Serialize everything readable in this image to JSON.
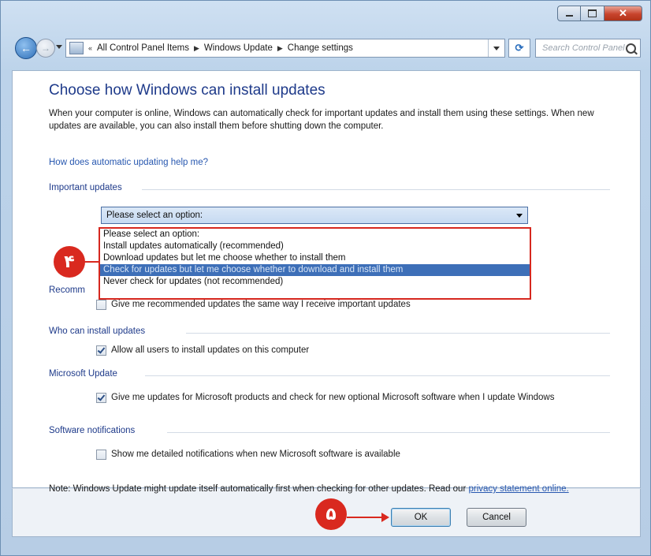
{
  "window": {
    "caption_buttons": [
      "minimize",
      "maximize",
      "close"
    ]
  },
  "nav": {
    "breadcrumb": [
      "All Control Panel Items",
      "Windows Update",
      "Change settings"
    ],
    "search_placeholder": "Search Control Panel"
  },
  "page": {
    "title": "Choose how Windows can install updates",
    "intro": "When your computer is online, Windows can automatically check for important updates and install them using these settings. When new updates are available, you can also install them before shutting down the computer.",
    "help_link": "How does automatic updating help me?"
  },
  "important_updates": {
    "label": "Important updates",
    "selected": "Please select an option:",
    "options": [
      "Please select an option:",
      "Install updates automatically (recommended)",
      "Download updates but let me choose whether to install them",
      "Check for updates but let me choose whether to download and install them",
      "Never check for updates (not recommended)"
    ],
    "highlighted_index": 3
  },
  "recommended_updates": {
    "label_partial": "Recomm",
    "checkbox_label": "Give me recommended updates the same way I receive important updates",
    "checked": false
  },
  "who_can_install": {
    "label": "Who can install updates",
    "checkbox_label": "Allow all users to install updates on this computer",
    "checked": true
  },
  "microsoft_update": {
    "label": "Microsoft Update",
    "checkbox_label": "Give me updates for Microsoft products and check for new optional Microsoft software when I update Windows",
    "checked": true
  },
  "software_notifications": {
    "label": "Software notifications",
    "checkbox_label": "Show me detailed notifications when new Microsoft software is available",
    "checked": false
  },
  "note": {
    "text": "Note: Windows Update might update itself automatically first when checking for other updates.  Read our",
    "link": "privacy statement online."
  },
  "buttons": {
    "ok": "OK",
    "cancel": "Cancel"
  },
  "badges": {
    "step_a": "۴",
    "step_b": "۵"
  },
  "colors": {
    "accent": "#d9291f",
    "title": "#1e3a8a",
    "link": "#2858b0",
    "highlight": "#3d6fb8"
  }
}
